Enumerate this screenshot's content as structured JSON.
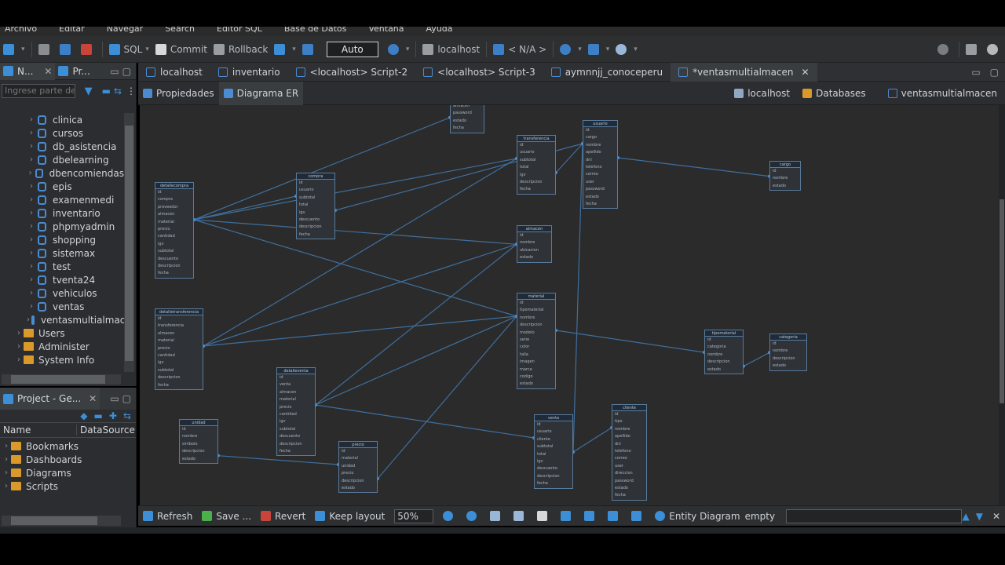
{
  "menu": [
    "Archivo",
    "Editar",
    "Navegar",
    "Search",
    "Editor SQL",
    "Base de Datos",
    "Ventana",
    "Ayuda"
  ],
  "toolbar": {
    "sql": "SQL",
    "commit": "Commit",
    "rollback": "Rollback",
    "mode": "Auto",
    "connection": "localhost",
    "schema": "< N/A >"
  },
  "navigator": {
    "tab1": "N...",
    "tab2": "Pr...",
    "filter_placeholder": "Ingrese parte del nombre",
    "databases": [
      "clinica",
      "cursos",
      "db_asistencia",
      "dbelearning",
      "dbencomiendas",
      "epis",
      "examenmedi",
      "inventario",
      "phpmyadmin",
      "shopping",
      "sistemax",
      "test",
      "tventa24",
      "vehiculos",
      "ventas",
      "ventasmultialmacen"
    ],
    "folders": [
      "Users",
      "Administer",
      "System Info"
    ]
  },
  "project": {
    "tab": "Project - Ge...",
    "col_name": "Name",
    "col_ds": "DataSource",
    "items": [
      "Bookmarks",
      "Dashboards",
      "Diagrams",
      "Scripts"
    ]
  },
  "editor_tabs": [
    "localhost",
    "inventario",
    "<localhost> Script-2",
    "<localhost> Script-3",
    "aymnnjj_conoceperu",
    "*ventasmultialmacen"
  ],
  "sub_tabs": [
    "Propiedades",
    "Diagrama ER"
  ],
  "crumbs": [
    "localhost",
    "Databases",
    "ventasmultialmacen"
  ],
  "bottom": {
    "refresh": "Refresh",
    "save": "Save ...",
    "revert": "Revert",
    "keep_layout": "Keep layout",
    "zoom": "50%",
    "status": "Entity Diagram",
    "status_value": "empty"
  },
  "entities": [
    {
      "name": "",
      "rows": [
        "almacen",
        "password",
        "estado",
        "fecha"
      ]
    },
    {
      "name": "transferencia",
      "rows": [
        "id",
        "usuario",
        "subtotal",
        "total",
        "igv",
        "descripcion",
        "fecha"
      ]
    },
    {
      "name": "usuario",
      "rows": [
        "id",
        "cargo",
        "nombre",
        "apellido",
        "dni",
        "telefono",
        "correo",
        "user",
        "password",
        "estado",
        "fecha"
      ]
    },
    {
      "name": "cargo",
      "rows": [
        "id",
        "nombre",
        "estado"
      ]
    },
    {
      "name": "compra",
      "rows": [
        "id",
        "usuario",
        "subtotal",
        "total",
        "igv",
        "descuento",
        "descripcion",
        "fecha"
      ]
    },
    {
      "name": "detallecompra",
      "rows": [
        "id",
        "compra",
        "proveedor",
        "almacen",
        "material",
        "precio",
        "cantidad",
        "igv",
        "subtotal",
        "descuento",
        "descripcion",
        "fecha"
      ]
    },
    {
      "name": "almacen",
      "rows": [
        "id",
        "nombre",
        "ubicacion",
        "estado"
      ]
    },
    {
      "name": "material",
      "rows": [
        "id",
        "tipomaterial",
        "nombre",
        "descripcion",
        "modelo",
        "serie",
        "color",
        "talla",
        "imagen",
        "marca",
        "codigo",
        "estado"
      ]
    },
    {
      "name": "detalletransferencia",
      "rows": [
        "id",
        "transferencia",
        "almacen",
        "material",
        "precio",
        "cantidad",
        "igv",
        "subtotal",
        "descripcion",
        "fecha"
      ]
    },
    {
      "name": "tipomaterial",
      "rows": [
        "id",
        "categoria",
        "nombre",
        "descripcion",
        "estado"
      ]
    },
    {
      "name": "categoria",
      "rows": [
        "id",
        "nombre",
        "descripcion",
        "estado"
      ]
    },
    {
      "name": "detalleventa",
      "rows": [
        "id",
        "venta",
        "almacen",
        "material",
        "precio",
        "cantidad",
        "igv",
        "subtotal",
        "descuento",
        "descripcion",
        "fecha"
      ]
    },
    {
      "name": "unidad",
      "rows": [
        "id",
        "nombre",
        "simbolo",
        "descripcion",
        "estado"
      ]
    },
    {
      "name": "precio",
      "rows": [
        "id",
        "material",
        "unidad",
        "precio",
        "descripcion",
        "estado"
      ]
    },
    {
      "name": "venta",
      "rows": [
        "id",
        "usuario",
        "cliente",
        "subtotal",
        "total",
        "igv",
        "descuento",
        "descripcion",
        "fecha"
      ]
    },
    {
      "name": "cliente",
      "rows": [
        "id",
        "tipo",
        "nombre",
        "apellido",
        "dni",
        "telefono",
        "correo",
        "user",
        "direccion",
        "password",
        "estado",
        "fecha"
      ]
    }
  ],
  "colors": {
    "accent": "#4b8bd0",
    "folder": "#d99a2b",
    "entity_border": "#587b9c"
  }
}
